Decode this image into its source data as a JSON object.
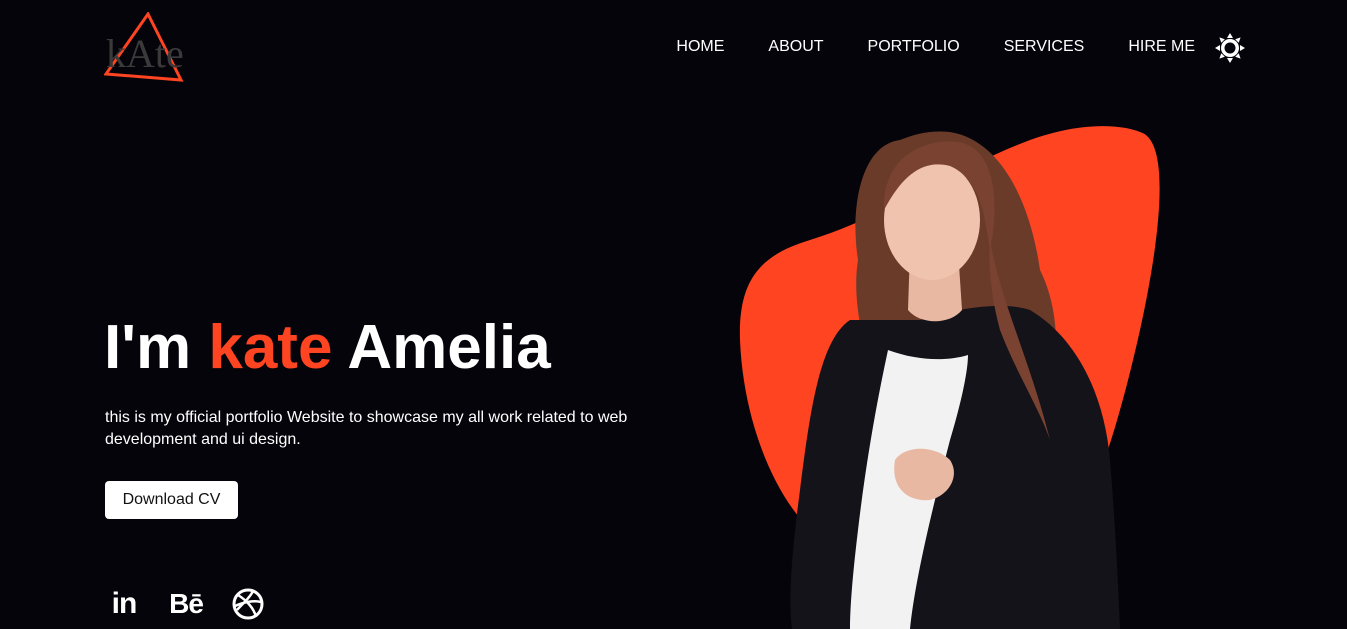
{
  "brand": {
    "logo_text": "kAte",
    "accent_color": "#ff4422",
    "background_color": "#05040a"
  },
  "nav": {
    "items": [
      {
        "label": "HOME"
      },
      {
        "label": "ABOUT"
      },
      {
        "label": "PORTFOLIO"
      },
      {
        "label": "SERVICES"
      },
      {
        "label": "HIRE ME"
      }
    ],
    "theme_toggle_icon": "sun-icon"
  },
  "hero": {
    "greeting": "I'm",
    "first_name": "kate",
    "last_name": "Amelia",
    "description": "this is my official portfolio Website to showcase my all work related to web development and ui design.",
    "cta_label": "Download CV",
    "image_icon": "portrait-photo"
  },
  "social": {
    "items": [
      {
        "icon": "linkedin-icon",
        "glyph": "in"
      },
      {
        "icon": "behance-icon",
        "glyph": "Bē"
      },
      {
        "icon": "dribbble-icon"
      }
    ]
  }
}
